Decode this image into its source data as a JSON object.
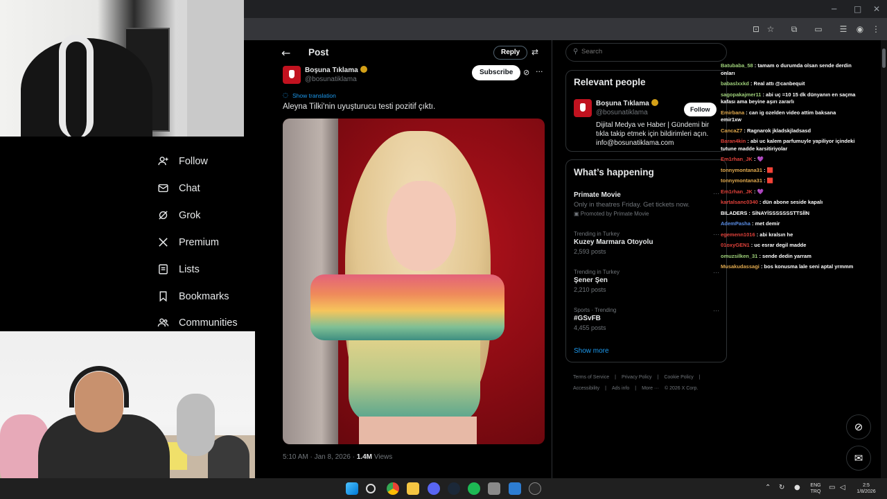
{
  "nav": {
    "items": [
      {
        "label": "Follow",
        "icon": "person-add-icon"
      },
      {
        "label": "Chat",
        "icon": "mail-icon"
      },
      {
        "label": "Grok",
        "icon": "grok-icon"
      },
      {
        "label": "Premium",
        "icon": "x-logo-icon"
      },
      {
        "label": "Lists",
        "icon": "list-icon"
      },
      {
        "label": "Bookmarks",
        "icon": "bookmark-icon"
      },
      {
        "label": "Communities",
        "icon": "people-icon"
      }
    ]
  },
  "post": {
    "header_title": "Post",
    "reply_label": "Reply",
    "author_name": "Boşuna Tıklama",
    "author_handle": "@bosunatiklama",
    "subscribe_label": "Subscribe",
    "show_translation": "Show translation",
    "text": "Aleyna Tilki'nin uyuşturucu testi pozitif çıktı.",
    "time": "5:10 AM · Jan 8, 2026 · ",
    "views": "1.4M",
    "views_label": " Views"
  },
  "search": {
    "placeholder": "Search"
  },
  "relevant": {
    "title": "Relevant people",
    "name": "Boşuna Tıklama",
    "handle": "@bosunatiklama",
    "follow_label": "Follow",
    "bio": "Dijital Medya ve Haber | Gündemi bir tıkla takip etmek için bildirimleri açın. info@bosunatiklama.com"
  },
  "happening": {
    "title": "What’s happening",
    "trends": [
      {
        "ctx": "",
        "name": "Primate Movie",
        "sub": "Only in theatres Friday. Get tickets now.",
        "promo": "Promoted by Primate Movie"
      },
      {
        "ctx": "Trending in Turkey",
        "name": "Kuzey Marmara Otoyolu",
        "sub": "2,593 posts"
      },
      {
        "ctx": "Trending in Turkey",
        "name": "Şener Şen",
        "sub": "2,210 posts"
      },
      {
        "ctx": "Sports · Trending",
        "name": "#GSvFB",
        "sub": "4,455 posts"
      }
    ],
    "show_more": "Show more"
  },
  "footer": {
    "links": [
      "Terms of Service",
      "|",
      "Privacy Policy",
      "|",
      "Cookie Policy",
      "|",
      "Accessibility",
      "|",
      "Ads info",
      "|",
      "More ···",
      "© 2026 X Corp."
    ]
  },
  "chat": {
    "messages": [
      {
        "user": "Batubaba_58",
        "text": "tamam o durumda olsan sende derdin onları",
        "color": "#9fd17a"
      },
      {
        "user": "babaslxxkd",
        "text": "Real attı @canbequit",
        "color": "#9fd17a"
      },
      {
        "user": "sagopakajmer11",
        "text": "abi uç =10 15 dk dünyanın en saçma kafası ama beyine aşırı zararlı",
        "color": "#9fd17a"
      },
      {
        "user": "Emirbana",
        "text": "can ig ozelden video attim baksana emir1xw",
        "color": "#e0a94e"
      },
      {
        "user": "CancaZ7",
        "text": "Ragnarok jkladskjladsasd",
        "color": "#e0a94e"
      },
      {
        "user": "Baran4kin",
        "text": "abi uc kalem parfumuyle yapiliyor içindeki tutune madde karsitiriyolar",
        "color": "#e0413a"
      },
      {
        "user": "Em1rhan_JK",
        "text": "💜",
        "color": "#e0413a"
      },
      {
        "user": "tonnymontana31",
        "text": "🟥",
        "color": "#e0a94e"
      },
      {
        "user": "tonnymontana31",
        "text": "🟥",
        "color": "#e0a94e"
      },
      {
        "user": "Em1rhan_JK",
        "text": "💜",
        "color": "#e0413a"
      },
      {
        "user": "kartalsanc0340",
        "text": "dün abone seside kapalı",
        "color": "#e0413a"
      },
      {
        "user": "BILADERS",
        "text": "SİNAYİSSSSSSSTTSİİN",
        "color": "#ffffff"
      },
      {
        "user": "AdemPasha",
        "text": "met demir",
        "color": "#5b8ee6"
      },
      {
        "user": "egemenn1016",
        "text": "abi kralsın he",
        "color": "#e0413a"
      },
      {
        "user": "01oxyGEN1",
        "text": "uc esrar degil madde",
        "color": "#e0413a"
      },
      {
        "user": "omuzsilken_31",
        "text": "sende dedin yarram",
        "color": "#9fd17a"
      },
      {
        "user": "Musakudassagi",
        "text": "bos konusma lale seni aptal yrmmm",
        "color": "#e0a94e"
      }
    ]
  },
  "taskbar": {
    "lang_top": "ENG",
    "lang_bottom": "TRQ",
    "clock_time": "2:5",
    "clock_date": "1/8/2026"
  },
  "colors": {
    "bg": "#000000",
    "accent": "#1d9bf0",
    "border": "#2f3336",
    "brand_red": "#c1121f"
  }
}
